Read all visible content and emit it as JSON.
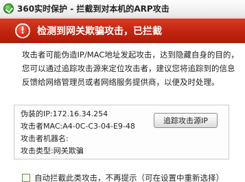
{
  "window": {
    "title": "360实时保护 - 拦截到对本机的ARP攻击"
  },
  "banner": {
    "message": "检测到网关欺骗攻击，已拦截",
    "icon": "warning-icon",
    "color": "#c1240f"
  },
  "description": {
    "lines": [
      "攻击者可能伪造IP/MAC地址发起攻击，达到隐藏自身的目的，",
      "您可以通过追踪攻击源来定位攻击者，建议您将追踪到的信息",
      "反馈给网络管理员或者网络服务提供商，以便及时处理。"
    ]
  },
  "attack_info": {
    "fake_ip_label": "伪装的IP:",
    "fake_ip_value": "172.16.34.254",
    "attacker_mac_label": "攻击者MAC:",
    "attacker_mac_value": "A4-0C-C3-04-E9-48",
    "attacker_host_label": "攻击者机器名:",
    "attacker_host_value": "",
    "attack_type_label": "攻击类型:",
    "attack_type_value": "网关欺骗",
    "trace_button": "追踪攻击源IP"
  },
  "options": {
    "auto_block_label": "自动拦截此类攻击，不再提示（可在设置中重新选择）",
    "auto_block_checked": false
  }
}
